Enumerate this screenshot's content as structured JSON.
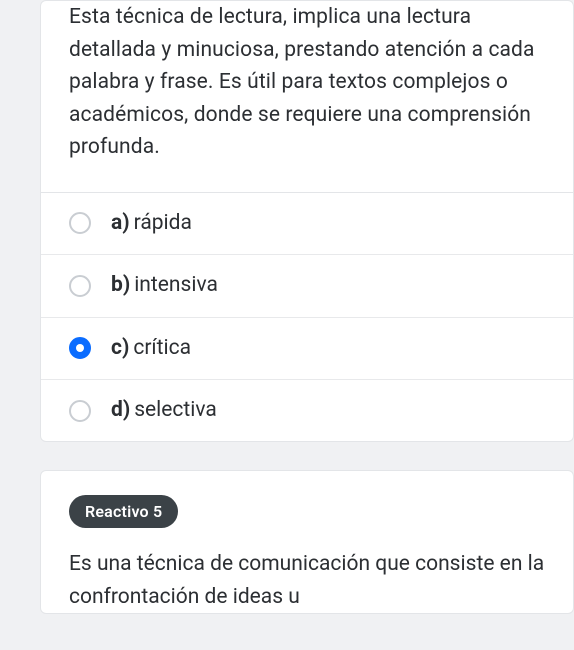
{
  "question4": {
    "prompt": "Esta técnica de lectura, implica una lectura detallada y minuciosa, prestando atención a cada palabra y frase. Es útil para textos complejos o académicos, donde se requiere una comprensión profunda.",
    "options": [
      {
        "letter": "a)",
        "text": "rápida",
        "selected": false
      },
      {
        "letter": "b)",
        "text": "intensiva",
        "selected": false
      },
      {
        "letter": "c)",
        "text": "crítica",
        "selected": true
      },
      {
        "letter": "d)",
        "text": "selectiva",
        "selected": false
      }
    ]
  },
  "question5": {
    "badge": "Reactivo 5",
    "prompt": "Es una técnica de comunicación que consiste en la confrontación de ideas u"
  }
}
